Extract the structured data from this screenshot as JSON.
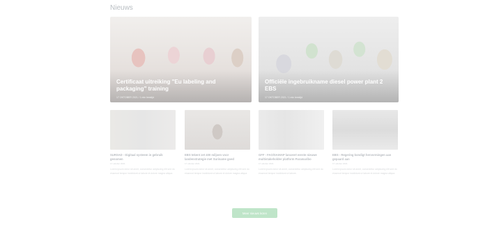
{
  "section": {
    "title": "Nieuws"
  },
  "featured": [
    {
      "title": "Certificaat uitreiking \"Eu labeling and packaging\" training",
      "meta": "17 OKTOBER 2021 / 1 min leestijd"
    },
    {
      "title": "Officiële ingebruikname diesel power plant 2 EBS",
      "meta": "17 OKTOBER 2021 / 1 min leestijd"
    }
  ],
  "cards": [
    {
      "title": "SURSAD - Digitaal systeem in gebruik genomen",
      "date": "17 oktober 2021",
      "excerpt": "Lorem ipsum dolor sit amet, consectetur adipiscing elit sed do eiusmod tempor incididunt ut labore et dolore magna aliqua."
    },
    {
      "title": "EBS tekent zet 400 miljoen voor landenstrategie met Suriname goed",
      "date": "17 oktober 2021",
      "excerpt": "Lorem ipsum dolor sit amet, consectetur adipiscing elit sed do eiusmod tempor incididunt ut labore et dolore magna aliqua."
    },
    {
      "title": "GFF - FAO/SAIHAP lanceert eerste nieuwe multistakeholder platform Paramaribo",
      "date": "17 oktober 2021",
      "excerpt": "Lorem ipsum dolor sit amet, consectetur adipiscing elit sed do eiusmod tempor incididunt ut labore."
    },
    {
      "title": "EBS - Regering kondigt hervormingen aan gepaard aan",
      "date": "17 oktober 2021",
      "excerpt": "Lorem ipsum dolor sit amet, consectetur adipiscing elit sed do eiusmod tempor incididunt ut labore et dolore magna aliqua."
    }
  ],
  "more_button": {
    "label": "Meer nieuws lezen"
  }
}
